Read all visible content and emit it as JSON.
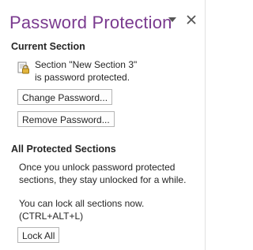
{
  "pane": {
    "title": "Password Protection",
    "dropdown_icon": "chevron-down-icon",
    "close_icon": "close-icon"
  },
  "current_section": {
    "heading": "Current Section",
    "lock_icon": "lock-icon",
    "message": "Section \"New Section 3\" is password protected.",
    "change_password_label": "Change Password...",
    "remove_password_label": "Remove Password..."
  },
  "all_sections": {
    "heading": "All Protected Sections",
    "info_text": "Once you unlock password protected sections, they stay unlocked for a while.",
    "lock_all_text_1": "You can lock all sections now.",
    "lock_all_text_2": "(CTRL+ALT+L)",
    "lock_all_label": "Lock All"
  },
  "colors": {
    "title": "#7a3a8f",
    "text": "#262626",
    "button_border": "#b5b5b5",
    "lock_gold": "#e2b43c"
  }
}
